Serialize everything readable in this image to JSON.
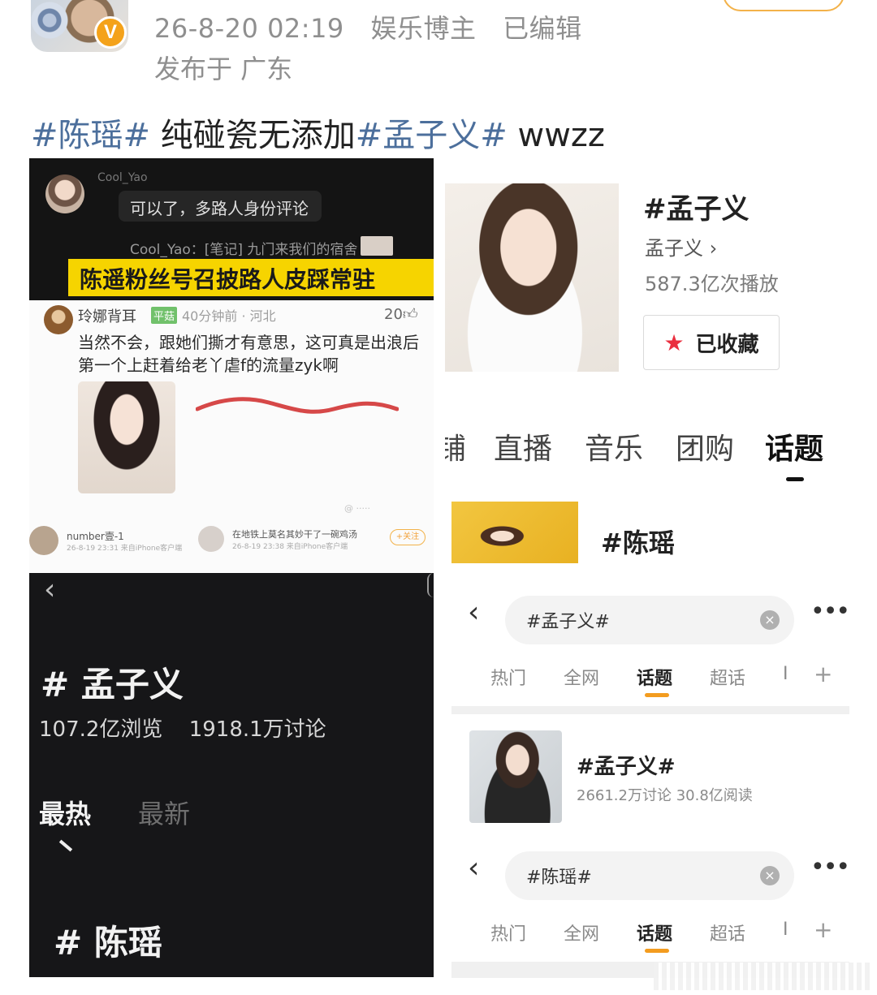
{
  "header": {
    "datetime": "26-8-20 02:19",
    "role": "娱乐博主",
    "edited": "已编辑",
    "location": "发布于 广东",
    "badge": "V"
  },
  "post": {
    "tag1": "#陈瑶#",
    "text1": " 纯碰瓷无添加",
    "tag2": "#孟子义#",
    "text2": " wwzz"
  },
  "panel_a": {
    "username": "Cool_Yao",
    "comment": "可以了，多路人身份评论",
    "note": "Cool_Yao：[笔记] 九门来我们的宿舍",
    "banner": "陈遥粉丝号召披路人皮踩常驻"
  },
  "panel_b": {
    "username": "玲娜背耳",
    "level": "平菇",
    "time": "40分钟前 · 河北",
    "likes": "20",
    "body": "当然不会，跟她们撕才有意思，这可真是出浪后第一个上赶着给老丫虐f的流量zyk啊",
    "foot_name1": "number壹-1",
    "foot_sub1": "26-8-19 23:31 来自iPhone客户端",
    "foot_name2": "在地铁上莫名其妙干了一碗鸡汤",
    "foot_sub2": "26-8-19 23:38 来自iPhone客户端",
    "foot_follow": "+关注"
  },
  "panel_c": {
    "back": "‹",
    "topic1": "# 孟子义",
    "views": "107.2亿浏览",
    "discussions": "1918.1万讨论",
    "tab_hot": "最热",
    "tab_new": "最新",
    "topic2": "# 陈瑶"
  },
  "panel_d": {
    "title": "#孟子义",
    "author": "孟子义 ›",
    "plays": "587.3亿次播放",
    "fav": "已收藏"
  },
  "panel_e": {
    "tabs": [
      "铺",
      "直播",
      "音乐",
      "团购",
      "话题"
    ]
  },
  "panel_f": {
    "name": "#陈瑶"
  },
  "search_g": {
    "query": "#孟子义#",
    "tabs": [
      "热门",
      "全网",
      "话题",
      "超话",
      "I"
    ],
    "result_title": "#孟子义#",
    "result_sub": "2661.2万讨论 30.8亿阅读"
  },
  "search_h": {
    "query": "#陈瑶#",
    "tabs": [
      "热门",
      "全网",
      "话题",
      "超话",
      "I"
    ]
  },
  "colors": {
    "tag_blue": "#4c6f9c",
    "orange": "#f39c1f",
    "banner_yellow": "#f6d400",
    "star_red": "#ea2f3f"
  }
}
